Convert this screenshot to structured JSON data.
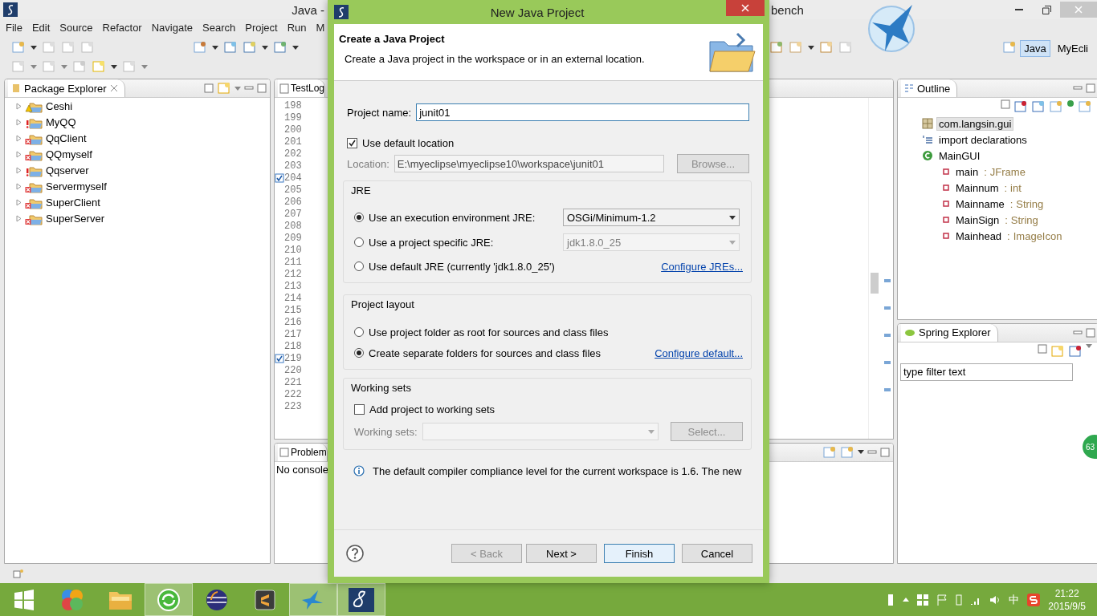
{
  "window": {
    "title_left": "Java -",
    "title_right": "bench"
  },
  "menu": [
    "File",
    "Edit",
    "Source",
    "Refactor",
    "Navigate",
    "Search",
    "Project",
    "Run",
    "M"
  ],
  "perspectives": [
    {
      "label": "Java",
      "selected": true
    },
    {
      "label": "MyEcli",
      "selected": false
    }
  ],
  "package_explorer": {
    "title": "Package Explorer",
    "projects": [
      {
        "name": "Ceshi",
        "kind": "warning"
      },
      {
        "name": "MyQQ",
        "kind": "error"
      },
      {
        "name": "QqClient",
        "kind": "broken"
      },
      {
        "name": "QQmyself",
        "kind": "broken"
      },
      {
        "name": "Qqserver",
        "kind": "error"
      },
      {
        "name": "Servermyself",
        "kind": "broken"
      },
      {
        "name": "SuperClient",
        "kind": "broken"
      },
      {
        "name": "SuperServer",
        "kind": "broken"
      }
    ]
  },
  "editor": {
    "tab": "TestLog",
    "lines": [
      {
        "number": "198",
        "task": false
      },
      {
        "number": "199",
        "task": false
      },
      {
        "number": "200",
        "task": false
      },
      {
        "number": "201",
        "task": false
      },
      {
        "number": "202",
        "task": false
      },
      {
        "number": "203",
        "task": false
      },
      {
        "number": "204",
        "task": true
      },
      {
        "number": "205",
        "task": false
      },
      {
        "number": "206",
        "task": false
      },
      {
        "number": "207",
        "task": false
      },
      {
        "number": "208",
        "task": false
      },
      {
        "number": "209",
        "task": false
      },
      {
        "number": "210",
        "task": false
      },
      {
        "number": "211",
        "task": false
      },
      {
        "number": "212",
        "task": false
      },
      {
        "number": "213",
        "task": false
      },
      {
        "number": "214",
        "task": false
      },
      {
        "number": "215",
        "task": false
      },
      {
        "number": "216",
        "task": false
      },
      {
        "number": "217",
        "task": false
      },
      {
        "number": "218",
        "task": false
      },
      {
        "number": "219",
        "task": true
      },
      {
        "number": "220",
        "task": false
      },
      {
        "number": "221",
        "task": false
      },
      {
        "number": "222",
        "task": false
      },
      {
        "number": "223",
        "task": false
      }
    ]
  },
  "console": {
    "tab": "Problem",
    "message": "No console"
  },
  "outline": {
    "title": "Outline",
    "items": [
      {
        "label": "com.langsin.gui",
        "kind": "package",
        "selected": true
      },
      {
        "label": "import declarations",
        "kind": "imports",
        "selected": false
      },
      {
        "label": "MainGUI",
        "kind": "class",
        "selected": false,
        "children": [
          {
            "label": "main",
            "separator": ":",
            "type": "JFrame",
            "kind": "field",
            "selected": false
          },
          {
            "label": "Mainnum",
            "separator": ":",
            "type": "int",
            "kind": "field",
            "selected": false
          },
          {
            "label": "Mainname",
            "separator": ":",
            "type": "String",
            "kind": "field",
            "selected": false
          },
          {
            "label": "MainSign",
            "separator": ":",
            "type": "String",
            "kind": "field",
            "selected": false
          },
          {
            "label": "Mainhead",
            "separator": ":",
            "type": "ImageIcon",
            "kind": "field",
            "selected": false
          }
        ]
      }
    ]
  },
  "spring_explorer": {
    "title": "Spring Explorer",
    "filter": {
      "value": "type filter text"
    }
  },
  "badge": "63",
  "dialog": {
    "title": "New Java Project",
    "heading": "Create a Java Project",
    "description": "Create a Java project in the workspace or in an external location.",
    "project_name": {
      "label": "Project name:",
      "value": "junit01"
    },
    "use_default_location": {
      "label": "Use default location",
      "checked": true
    },
    "location": {
      "label": "Location:",
      "value": "E:\\myeclipse\\myeclipse10\\workspace\\junit01",
      "disabled": true,
      "button": "Browse..."
    },
    "jre": {
      "title": "JRE",
      "options": [
        {
          "label": "Use an execution environment JRE:",
          "selected": true,
          "kind": "select",
          "value": "OSGi/Minimum-1.2",
          "disabled": false
        },
        {
          "label": "Use a project specific JRE:",
          "selected": false,
          "kind": "select",
          "value": "jdk1.8.0_25",
          "disabled": true
        },
        {
          "label": "Use default JRE (currently 'jdk1.8.0_25')",
          "selected": false,
          "kind": "link",
          "value": "Configure JREs..."
        }
      ]
    },
    "layout": {
      "title": "Project layout",
      "options": [
        {
          "label": "Use project folder as root for sources and class files",
          "selected": false
        },
        {
          "label": "Create separate folders for sources and class files",
          "selected": true,
          "link": "Configure default..."
        }
      ]
    },
    "working_sets": {
      "title": "Working sets",
      "checkbox": {
        "label": "Add project to working sets",
        "checked": false
      },
      "field_label": "Working sets:",
      "button": "Select...",
      "disabled": true
    },
    "info": "The default compiler compliance level for the current workspace is 1.6. The new",
    "buttons": [
      {
        "label": "< Back",
        "disabled": true,
        "default": false
      },
      {
        "label": "Next >",
        "disabled": false,
        "default": false
      },
      {
        "label": "Finish",
        "disabled": false,
        "default": true
      },
      {
        "label": "Cancel",
        "disabled": false,
        "default": false
      }
    ]
  },
  "taskbar": {
    "apps": [
      {
        "kind": "start",
        "active": false
      },
      {
        "kind": "balls",
        "active": false
      },
      {
        "kind": "folder",
        "active": false
      },
      {
        "kind": "refresh",
        "active": true
      },
      {
        "kind": "sphere",
        "active": false
      },
      {
        "kind": "sublime",
        "active": false
      },
      {
        "kind": "bird",
        "active": true
      },
      {
        "kind": "eight",
        "active": true
      }
    ],
    "ime": "中",
    "time": "21:22",
    "date": "2015/9/5"
  }
}
